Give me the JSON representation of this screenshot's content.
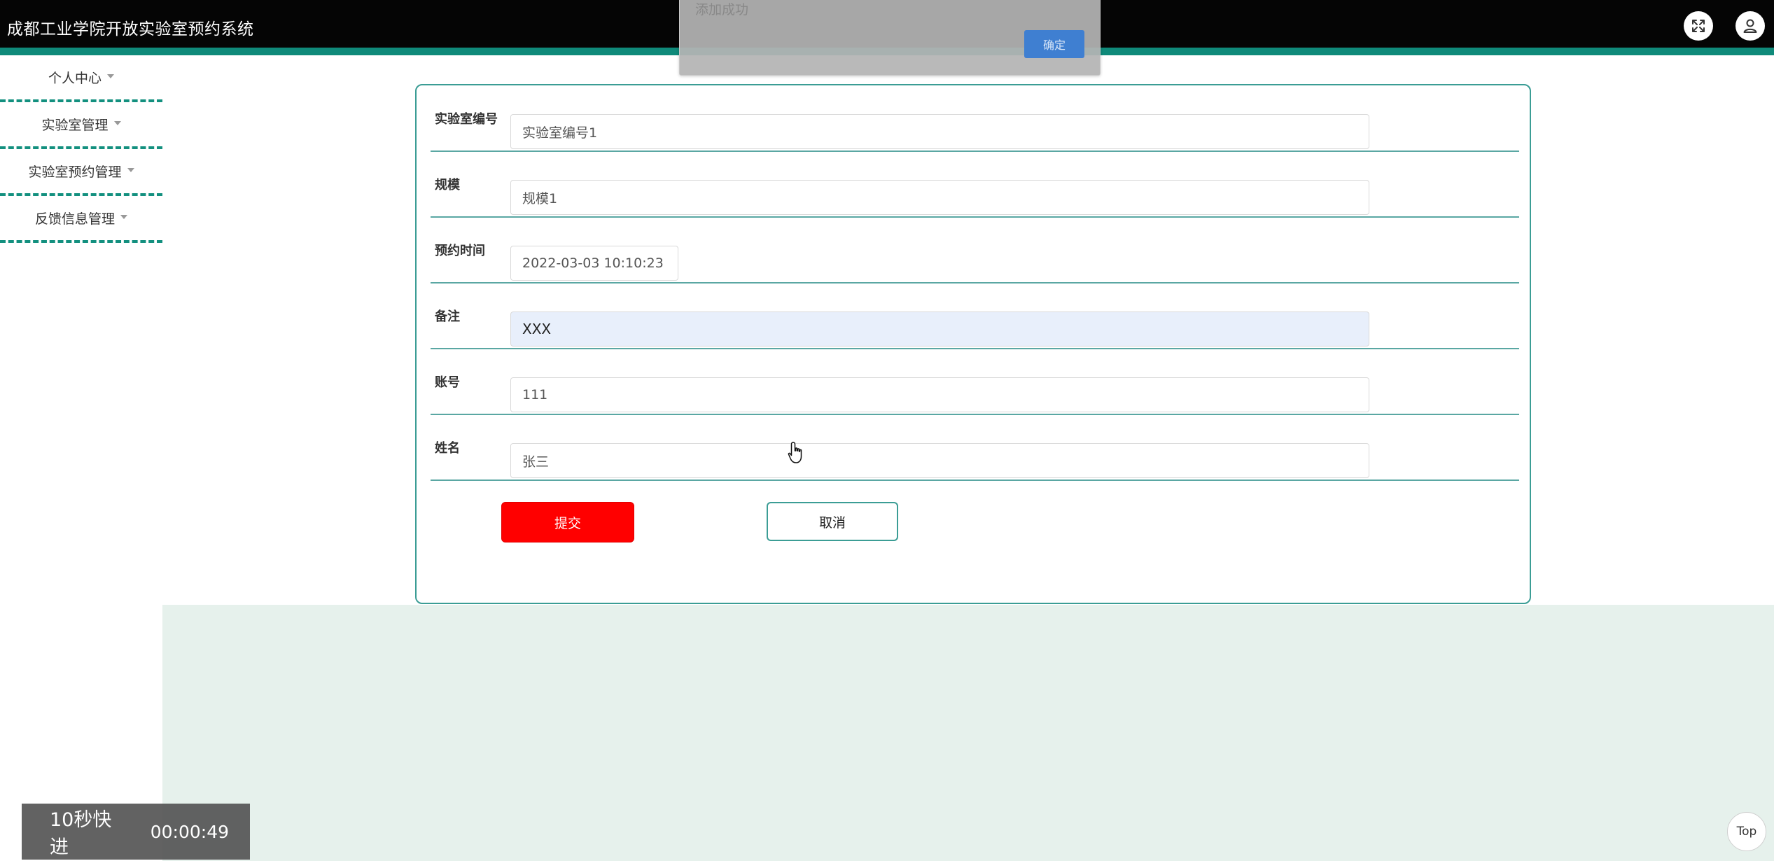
{
  "header": {
    "title": "成都工业学院开放实验室预约系统",
    "fullscreen_icon": "expand-arrows-icon",
    "user_icon": "user-icon"
  },
  "sidebar": {
    "items": [
      {
        "label": "个人中心"
      },
      {
        "label": "实验室管理"
      },
      {
        "label": "实验室预约管理"
      },
      {
        "label": "反馈信息管理"
      }
    ]
  },
  "form": {
    "fields": [
      {
        "label": "实验室编号",
        "value": "实验室编号1"
      },
      {
        "label": "规模",
        "value": "规模1"
      },
      {
        "label": "预约时间",
        "value": "2022-03-03 10:10:23"
      },
      {
        "label": "备注",
        "value": "XXX"
      },
      {
        "label": "账号",
        "value": "111"
      },
      {
        "label": "姓名",
        "value": "张三"
      }
    ],
    "submit_label": "提交",
    "cancel_label": "取消"
  },
  "toast": {
    "message": "添加成功",
    "ok_label": "确定"
  },
  "video_overlay": {
    "skip_label": "10秒快进",
    "time": "00:00:49"
  },
  "back_to_top_label": "Top",
  "colors": {
    "header_bg": "#050505",
    "accent": "#0f8a7a",
    "submit": "#ff0000",
    "lower_bg": "#e6f1ec"
  }
}
